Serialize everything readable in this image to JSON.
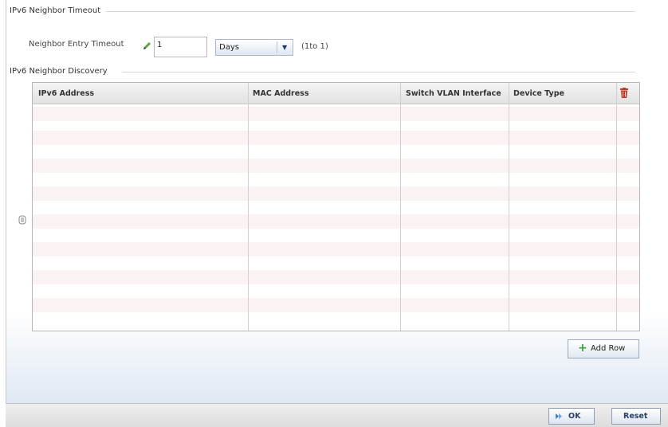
{
  "timeout_section": {
    "title": "IPv6 Neighbor Timeout",
    "field_label": "Neighbor Entry Timeout",
    "value": "1",
    "unit_selected": "Days",
    "range_hint": "(1to 1)"
  },
  "discovery_section": {
    "title": "IPv6 Neighbor Discovery",
    "columns": [
      "IPv6 Address",
      "MAC Address",
      "Switch VLAN Interface",
      "Device Type"
    ],
    "rows": []
  },
  "actions": {
    "add_row": "Add Row",
    "ok": "OK",
    "reset": "Reset"
  },
  "icons": {
    "edit": "pencil-icon",
    "delete": "trash-icon",
    "add": "plus-icon",
    "ok": "check-arrow-icon",
    "handle": "drag-handle-icon"
  },
  "colors": {
    "trash_red": "#c0392b",
    "add_green": "#3aa13a",
    "row_alt": "#fbf3f3"
  }
}
